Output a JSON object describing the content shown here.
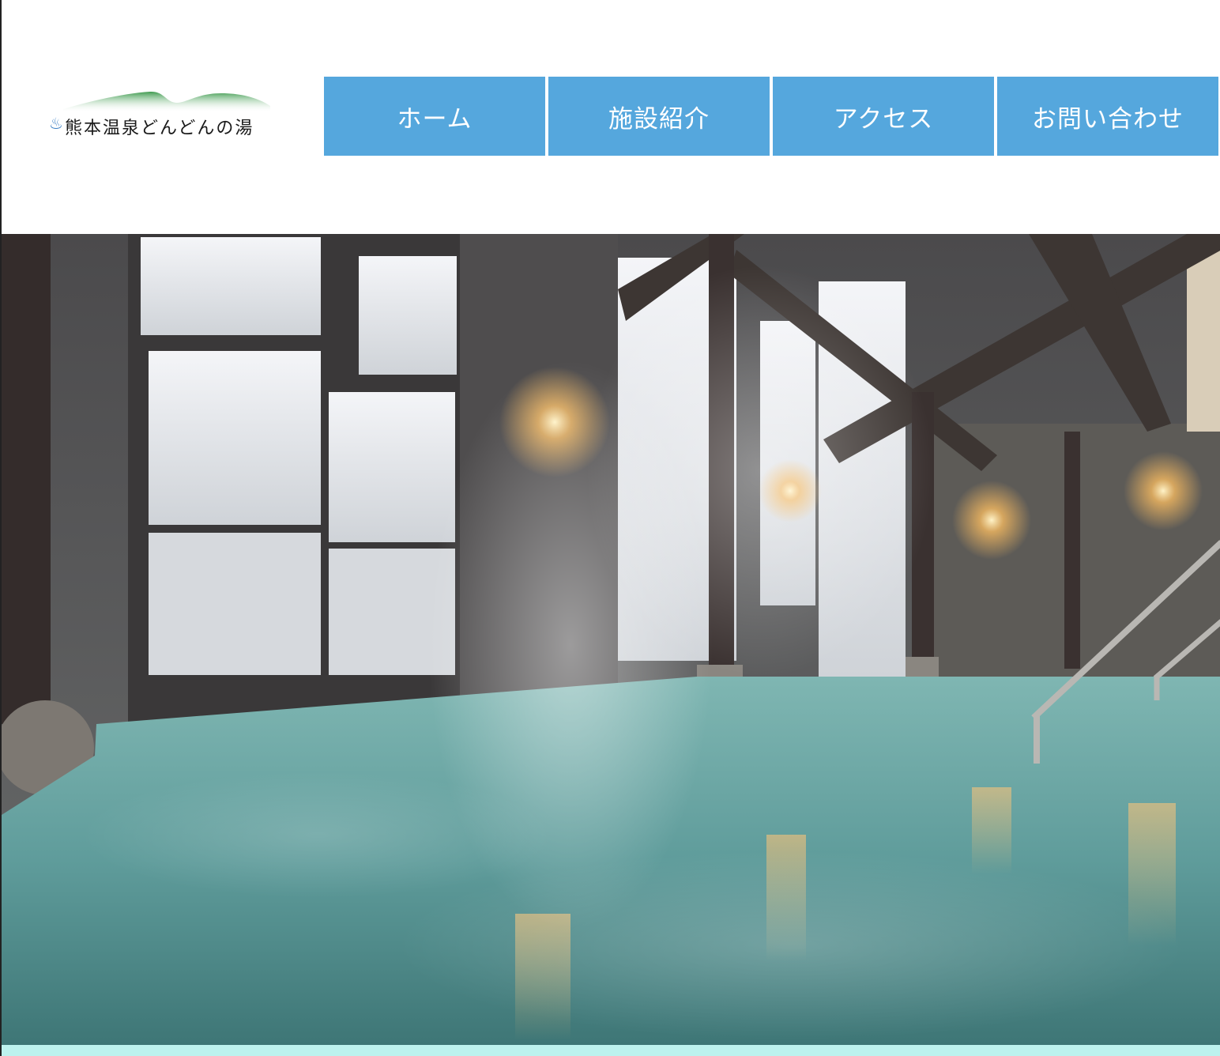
{
  "header": {
    "logo": {
      "text": "熊本温泉どんどんの湯",
      "icon": "hot-spring-icon",
      "hill_color": "#4aa35a"
    }
  },
  "nav": {
    "items": [
      {
        "label": "ホーム"
      },
      {
        "label": "施設紹介"
      },
      {
        "label": "アクセス"
      },
      {
        "label": "お問い合わせ"
      }
    ],
    "color": "#55a7dd"
  },
  "hero": {
    "image": "indoor-hot-spring-bath-photo"
  },
  "colors": {
    "accent": "#55a7dd",
    "bottom_strip": "#bdf2ee"
  }
}
